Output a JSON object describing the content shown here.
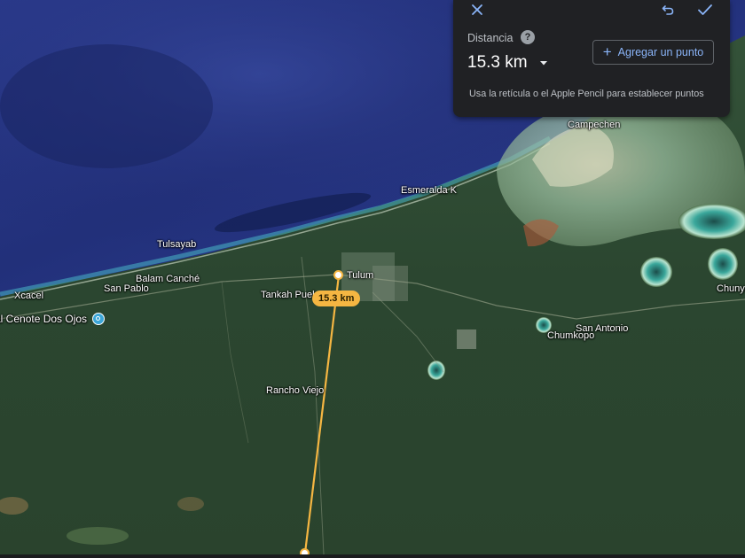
{
  "panel": {
    "close_icon": "close-icon",
    "undo_icon": "undo-icon",
    "confirm_icon": "check-icon",
    "distance_label": "Distancia",
    "help_icon": "help-icon",
    "help_glyph": "?",
    "distance_value": "15.3 km",
    "unit_dropdown_icon": "arrow-drop-down-icon",
    "add_point_label": "Agregar un punto",
    "add_point_icon": "plus-icon",
    "hint": "Usa la retícula o el Apple Pencil para establecer puntos"
  },
  "measurement": {
    "badge_text": "15.3 km",
    "line_color": "#f5b642"
  },
  "places": {
    "campechen": "Campechen",
    "esmeralda": "Esmeralda K",
    "tulsayab": "Tulsayab",
    "balam_canche": "Balam Canché",
    "san_pablo": "San Pablo",
    "xcacel": "Xcacel",
    "cenote_dos_ojos": "al Cenote Dos Ojos",
    "tankah_pueblo": "Tankah Puel",
    "tulum": "Tulum",
    "chumkopo": "Chumkopo",
    "san_antonio": "San Antonio",
    "chunya": "Chunya",
    "rancho_viejo": "Rancho Viejo"
  },
  "colors": {
    "ocean_deep": "#1d2a6b",
    "ocean_mid": "#2d3f94",
    "reef": "#2f9fb0",
    "land": "#2e4a30",
    "panel_bg": "#202124",
    "accent_blue": "#8ab4f8",
    "measure_yellow": "#f5b642"
  }
}
